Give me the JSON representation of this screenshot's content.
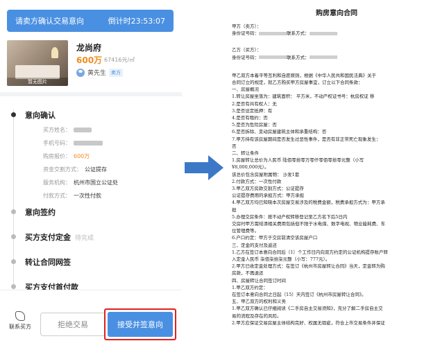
{
  "phone": {
    "topbar": {
      "title": "请卖方确认交易意向",
      "countdown": "倒计时23:53:07"
    },
    "listing": {
      "thumb_caption": "暂无图片",
      "name": "龙尚府",
      "price": "600万",
      "unit_price": "67416元/㎡",
      "agent_name": "黄先生",
      "agent_badge": "卖方"
    },
    "steps": [
      {
        "title": "意向确认",
        "note": "",
        "active": true
      },
      {
        "title": "意向签约",
        "note": "",
        "active": false
      },
      {
        "title": "买方支付定金",
        "note": "待完成",
        "active": false
      },
      {
        "title": "转让合同网签",
        "note": "",
        "active": false
      },
      {
        "title": "买方支付首付款",
        "note": "",
        "active": false
      }
    ],
    "details": [
      {
        "label": "买方姓名：",
        "value": "",
        "blurred": true
      },
      {
        "label": "手机号码：",
        "value": "",
        "blurred": true
      },
      {
        "label": "购房报价：",
        "value": "600万",
        "orange": true
      },
      {
        "label": "资金交割方式：",
        "value": "公证提存"
      },
      {
        "label": "服务机构：",
        "value": "杭州市国立公证处"
      },
      {
        "label": "付款方式：",
        "value": "一次性付款"
      }
    ],
    "bottom": {
      "contact_label": "联系买方",
      "reject_label": "拒绝交易",
      "accept_label": "接受并签意向"
    }
  },
  "doc": {
    "title": "购房意向合同",
    "lines": [
      {
        "text": "甲方（卖方）："
      },
      {
        "text": "身份证号码：",
        "blur": true,
        "tail": "联系方式："
      },
      {
        "text": "乙方（买方）："
      },
      {
        "text": "身份证号码：",
        "blur": true,
        "tail": "联系方式："
      },
      {
        "text": "甲乙双方本着平等互利和自愿原则，根据《中华人民共和国民法典》关于"
      },
      {
        "text": "合同订立的规定，就乙方购买甲方房屋事宜，订立以下合同条款："
      },
      {
        "text": "一、房屋概况"
      },
      {
        "text": "1.转让房屋坐落为：建筑面积：   平方米，不动产权证书号：杭房权证   移"
      },
      {
        "text": "2.是否有共有权人：无"
      },
      {
        "text": "3.是否设定抵押：有"
      },
      {
        "text": "4.是否有租约：否"
      },
      {
        "text": "5.是否为危险房屋：否"
      },
      {
        "text": "6.是否拆除、变动房屋建筑主体和承重结构：否"
      },
      {
        "text": "7.甲方持有该房屋期间是否发生过恶性事件，是否有非正常死亡现象发生："
      },
      {
        "text": "否"
      },
      {
        "text": "二、转让条件"
      },
      {
        "text": "1.房屋转让总价为人民币 陆佰零拾零万零仟零佰零拾零元整（小写"
      },
      {
        "text": "¥8,000,000元）。"
      },
      {
        "text": "该总价包含房屋附属物：   沙发1套"
      },
      {
        "text": "2.付款方式：一次性付款"
      },
      {
        "text": "3.甲乙双方房款交割方式：公证提存"
      },
      {
        "text": "公证提存费用的承担方式：甲方承担"
      },
      {
        "text": "4.甲乙双方均已知晓本次房屋交易涉及的税费金额，税费承担方式为：甲方承"
      },
      {
        "text": "担"
      },
      {
        "text": "5.办理交房条件：按不动产权转移登记至乙方名下后5日内"
      },
      {
        "text": "交房时甲方需结清相关费用包括但不限于水电煤、数字电视、物业能耗费、车"
      },
      {
        "text": "位管理费等。"
      },
      {
        "text": "6.户口约定：甲方于交房前清空该房屋户口"
      },
      {
        "text": "三、定金的支付及返还"
      },
      {
        "text": "1.乙方在签订本意向合同后（1）个工作日内向双方约定的公证机构提存账户转"
      },
      {
        "text": "入定金人民币      柒佰柒拾柒元整（小写：777元）。"
      },
      {
        "text": "2.甲方已收定金处理方式：在签订《杭州市房屋转让合同》当天，定金转为购"
      },
      {
        "text": "房款，不再退还"
      },
      {
        "text": "四、房屋转让合同签订时间"
      },
      {
        "text": "1.甲乙双方约定："
      },
      {
        "text": "在签订本意向合同之日起（15）天内签订《杭州市房屋转让合同》。"
      },
      {
        "text": "五、甲乙双方的权利和义务"
      },
      {
        "text": "1.甲乙双方确认已仔细阅读《二手房自主交易须知》，充分了解二手房自主交"
      },
      {
        "text": "易的流程及存在的风险。"
      },
      {
        "text": "2.甲方应保证交易房屋主体结构完好、权属无瑕疵，符合上市交易条件并保证"
      }
    ]
  },
  "colors": {
    "accent": "#4a90e2",
    "price": "#f08c1c",
    "highlight_border": "#e02020"
  }
}
